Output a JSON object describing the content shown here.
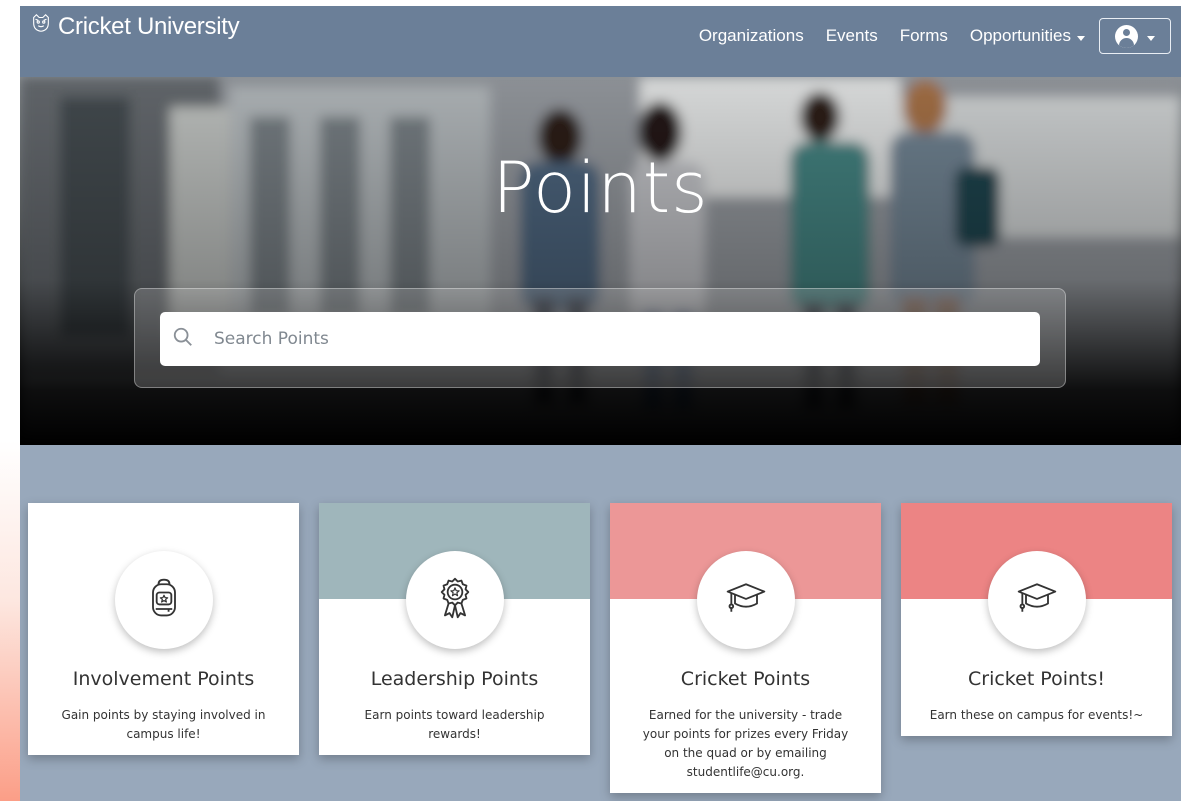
{
  "brand": {
    "name": "Cricket University",
    "logo_icon": "cricket-logo-icon"
  },
  "nav": {
    "items": [
      {
        "label": "Organizations"
      },
      {
        "label": "Events"
      },
      {
        "label": "Forms"
      },
      {
        "label": "Opportunities",
        "has_dropdown": true
      }
    ],
    "user_icon": "user-avatar-icon"
  },
  "hero": {
    "title": "Points"
  },
  "search": {
    "placeholder": "Search Points",
    "value": ""
  },
  "cards": [
    {
      "title": "Involvement Points",
      "description": "Gain points by staying involved in campus life!",
      "icon": "backpack-icon",
      "band_color": "#ffffff"
    },
    {
      "title": "Leadership Points",
      "description": "Earn points toward leadership rewards!",
      "icon": "award-ribbon-icon",
      "band_color": "#9fb6bb"
    },
    {
      "title": "Cricket Points",
      "description": "Earned for the university - trade your points for prizes every Friday on the quad or by emailing studentlife@cu.org.",
      "icon": "graduation-cap-icon",
      "band_color": "#ec9797"
    },
    {
      "title": "Cricket Points!",
      "description": "Earn these on campus for events!~",
      "icon": "graduation-cap-icon",
      "band_color": "#ec8484"
    }
  ],
  "colors": {
    "navbar": "#6b7f98",
    "page_background": "#98a8bb"
  }
}
